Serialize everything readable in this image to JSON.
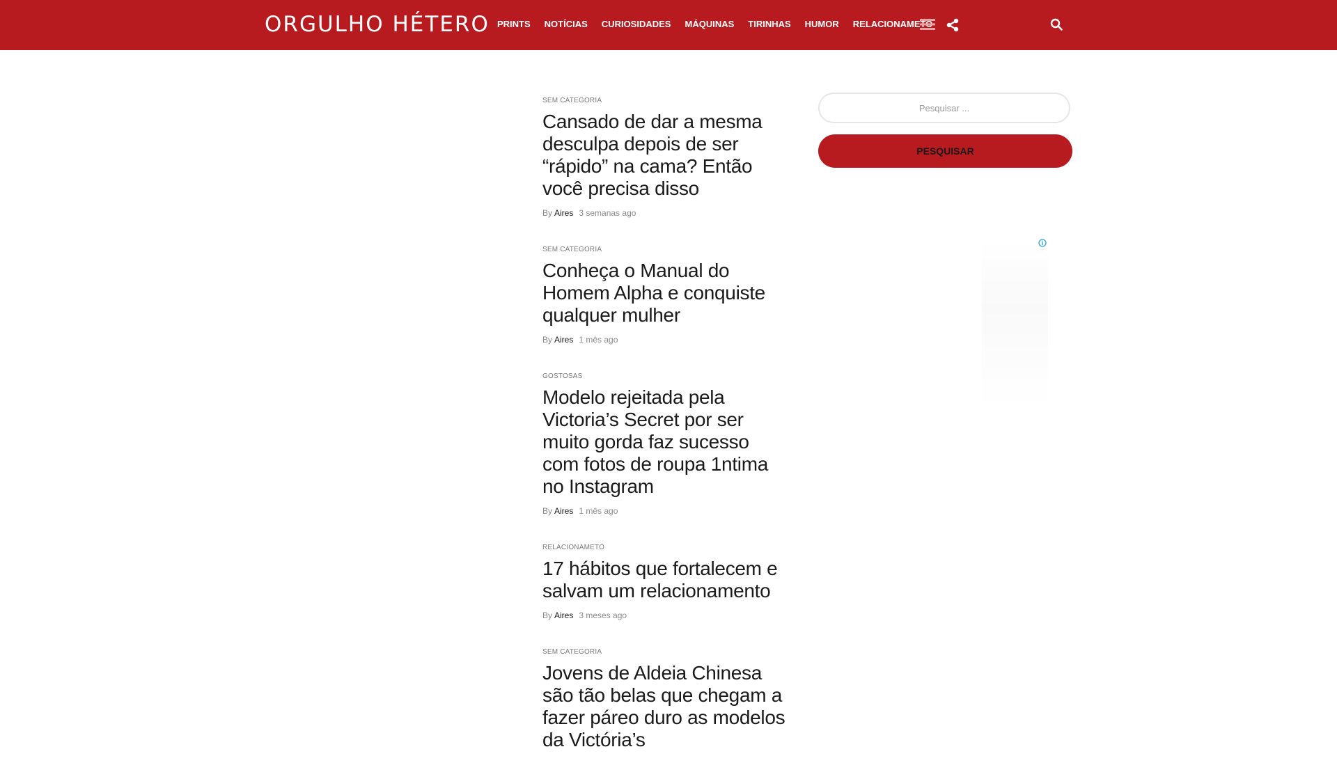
{
  "header": {
    "logo": "ORGULHO HÉTERO",
    "nav": [
      "PRINTS",
      "NOTÍCIAS",
      "CURIOSIDADES",
      "MÁQUINAS",
      "TIRINHAS",
      "HUMOR",
      "RELACIONAMETO"
    ]
  },
  "articles": [
    {
      "category": "SEM CATEGORIA",
      "title": "Cansado de dar a mesma desculpa depois de ser “rápido” na cama? Então você precisa disso",
      "by": "By",
      "author": "Aires",
      "time": "3 semanas ago"
    },
    {
      "category": "SEM CATEGORIA",
      "title": "Conheça o Manual do Homem Alpha e conquiste qualquer mulher",
      "by": "By",
      "author": "Aires",
      "time": "1 mês ago"
    },
    {
      "category": "GOSTOSAS",
      "title": "Modelo rejeitada pela Victoria’s Secret por ser muito gorda faz sucesso com fotos de roupa 1ntima no Instagram",
      "by": "By",
      "author": "Aires",
      "time": "1 mês ago"
    },
    {
      "category": "RELACIONAMETO",
      "title": "17 hábitos que fortalecem e salvam um relacionamento",
      "by": "By",
      "author": "Aires",
      "time": "3 meses ago"
    },
    {
      "category": "SEM CATEGORIA",
      "title": "Jovens de Aldeia Chinesa são tão belas que chegam a fazer páreo duro as modelos da Victória’s",
      "by": "",
      "author": "",
      "time": ""
    }
  ],
  "sidebar": {
    "search_placeholder": "Pesquisar ...",
    "search_value": "",
    "search_button": "PESQUISAR"
  },
  "icons": {
    "menu": "hamburger-icon",
    "share": "share-icon",
    "search": "search-icon",
    "ad_info": "info-icon"
  },
  "colors": {
    "brand_red": "#b71b1f",
    "text_dark": "#1a1a1a",
    "text_muted": "#8a8a8a"
  }
}
